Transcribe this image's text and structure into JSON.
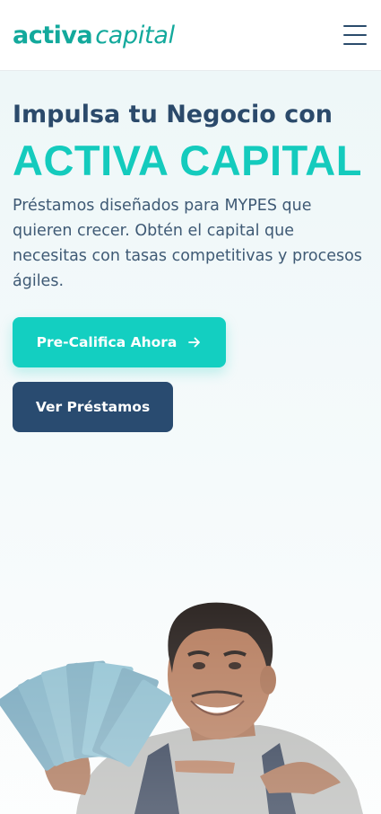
{
  "header": {
    "logo_main": "activa",
    "logo_sub": "capital",
    "menu_icon": "hamburger-menu-icon"
  },
  "hero": {
    "title_line1": "Impulsa tu Negocio con",
    "title_line2": "ACTIVA CAPITAL",
    "description": "Préstamos diseñados para MYPES que quieren crecer. Obtén el capital que necesitas con tasas competitivas y procesos ágiles.",
    "primary_button": "Pre-Califica Ahora",
    "primary_button_icon": "arrow-right-icon",
    "secondary_button": "Ver Préstamos",
    "image": "man-holding-banknotes-photo"
  },
  "colors": {
    "brand_teal": "#13a99c",
    "accent_cyan": "#14cbbd",
    "navy": "#294b70",
    "text": "#3f5a75"
  }
}
